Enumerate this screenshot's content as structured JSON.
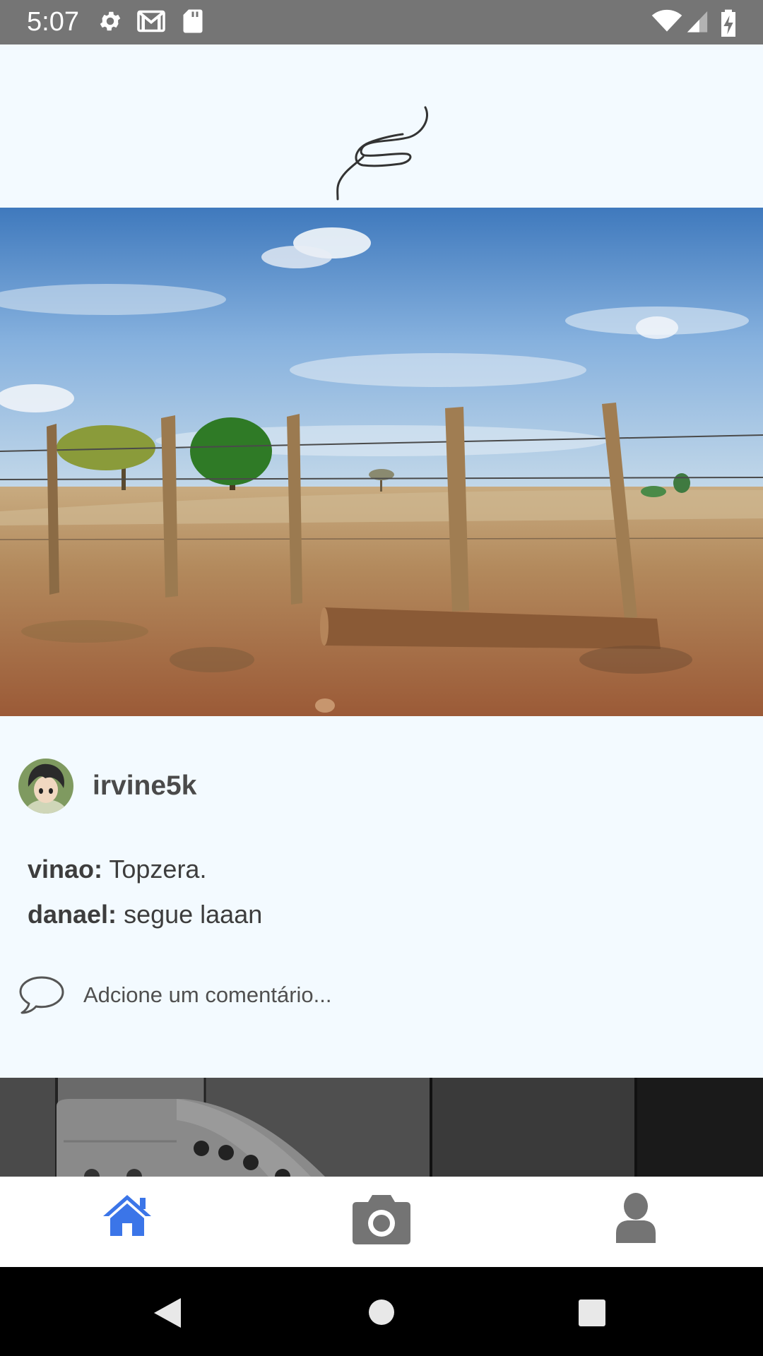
{
  "status_bar": {
    "time": "5:07",
    "left_icons": [
      "settings-icon",
      "gmail-icon",
      "sd-card-icon"
    ],
    "right_icons": [
      "wifi-icon",
      "signal-icon",
      "battery-charging-icon"
    ]
  },
  "header": {
    "logo": "app-logo-scribble"
  },
  "post": {
    "image": "landscape-photo-dry-field-fence-posts",
    "author": {
      "username": "irvine5k",
      "avatar": "avatar-anime-character"
    },
    "comments": [
      {
        "user": "vinao:",
        "text": "Topzera."
      },
      {
        "user": "danael:",
        "text": "segue laaan"
      }
    ],
    "add_comment": {
      "icon": "speech-bubble-icon",
      "placeholder": "Adcione um comentário..."
    }
  },
  "next_post": {
    "image": "grayscale-photo-wooden-door"
  },
  "tab_bar": {
    "active_color": "#3b75e8",
    "inactive_color": "#747474",
    "tabs": [
      {
        "icon": "home-icon",
        "active": true
      },
      {
        "icon": "camera-icon",
        "active": false
      },
      {
        "icon": "profile-icon",
        "active": false
      }
    ]
  },
  "nav_bar": {
    "buttons": [
      "back-icon",
      "home-circle-icon",
      "recents-icon"
    ]
  }
}
